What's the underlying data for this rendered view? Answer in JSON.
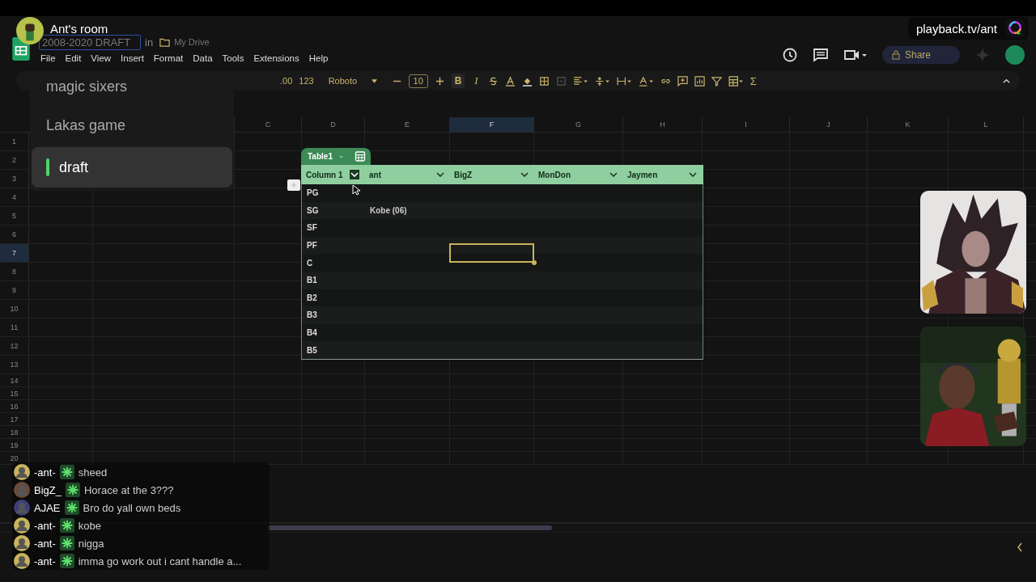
{
  "stream": {
    "room_title": "Ant's room",
    "link": "playback.tv/ant"
  },
  "rooms": [
    {
      "label": "magic sixers",
      "selected": false
    },
    {
      "label": "Lakas game",
      "selected": false
    },
    {
      "label": "draft",
      "selected": true
    }
  ],
  "sheet": {
    "doc_title": "2008-2020 DRAFT",
    "in": "in",
    "location": "My Drive",
    "menus": [
      "File",
      "Edit",
      "View",
      "Insert",
      "Format",
      "Data",
      "Tools",
      "Extensions",
      "Help"
    ],
    "share": "Share",
    "toolbar": {
      "increase_decimal": ".00",
      "number_format": "123",
      "font": "Roboto",
      "font_size": "10",
      "bold": "B",
      "italic": "I",
      "sum": "Σ"
    },
    "columns": [
      {
        "label": "C",
        "selected": false
      },
      {
        "label": "D",
        "selected": false
      },
      {
        "label": "E",
        "selected": false
      },
      {
        "label": "F",
        "selected": true
      },
      {
        "label": "G",
        "selected": false
      },
      {
        "label": "H",
        "selected": false
      },
      {
        "label": "I",
        "selected": false
      },
      {
        "label": "J",
        "selected": false
      },
      {
        "label": "K",
        "selected": false
      },
      {
        "label": "L",
        "selected": false
      }
    ],
    "rows": [
      {
        "label": "1",
        "selected": false
      },
      {
        "label": "2",
        "selected": false
      },
      {
        "label": "3",
        "selected": false
      },
      {
        "label": "4",
        "selected": false
      },
      {
        "label": "5",
        "selected": false
      },
      {
        "label": "6",
        "selected": false
      },
      {
        "label": "7",
        "selected": true
      },
      {
        "label": "8",
        "selected": false
      },
      {
        "label": "9",
        "selected": false
      },
      {
        "label": "10",
        "selected": false
      },
      {
        "label": "11",
        "selected": false
      },
      {
        "label": "12",
        "selected": false
      },
      {
        "label": "13",
        "selected": false
      },
      {
        "label": "14",
        "selected": false
      },
      {
        "label": "15",
        "selected": false
      },
      {
        "label": "16",
        "selected": false
      },
      {
        "label": "17",
        "selected": false
      },
      {
        "label": "18",
        "selected": false
      },
      {
        "label": "19",
        "selected": false
      },
      {
        "label": "20",
        "selected": false
      }
    ]
  },
  "table": {
    "name": "Table1",
    "headers": [
      "Column 1",
      "ant",
      "BigZ",
      "MonDon",
      "Jaymen"
    ],
    "rows": [
      {
        "cells": [
          "PG"
        ]
      },
      {
        "cells": [
          "SG",
          "Kobe (06)"
        ]
      },
      {
        "cells": [
          "SF"
        ]
      },
      {
        "cells": [
          "PF"
        ]
      },
      {
        "cells": [
          "C"
        ]
      },
      {
        "cells": [
          "B1"
        ]
      },
      {
        "cells": [
          "B2"
        ]
      },
      {
        "cells": [
          "B3"
        ]
      },
      {
        "cells": [
          "B4"
        ]
      },
      {
        "cells": [
          "B5"
        ]
      }
    ]
  },
  "chat": [
    {
      "user": "-ant-",
      "text": "sheed"
    },
    {
      "user": "BigZ_",
      "text": "Horace at the 3???"
    },
    {
      "user": "AJAE",
      "text": "Bro do yall own beds"
    },
    {
      "user": "-ant-",
      "text": "kobe"
    },
    {
      "user": "-ant-",
      "text": "nigga"
    },
    {
      "user": "-ant-",
      "text": "imma go work out i cant handle a..."
    }
  ]
}
